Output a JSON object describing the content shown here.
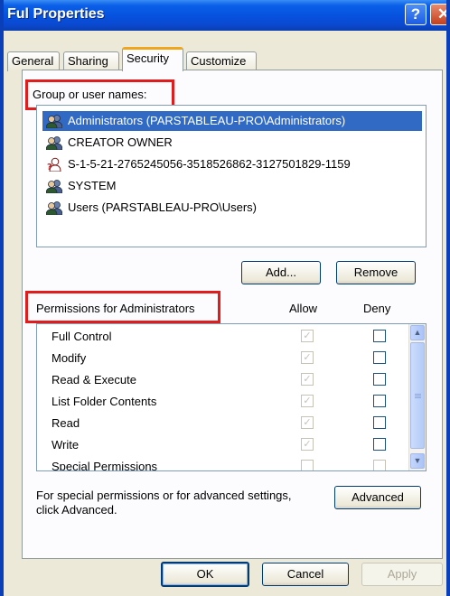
{
  "window": {
    "title": "Ful Properties",
    "help_glyph": "?",
    "close_glyph": "✕"
  },
  "tabs": [
    {
      "label": "General"
    },
    {
      "label": "Sharing"
    },
    {
      "label": "Security"
    },
    {
      "label": "Customize"
    }
  ],
  "users": {
    "heading": "Group or user names:",
    "items": [
      {
        "label": "Administrators (PARSTABLEAU-PRO\\Administrators)",
        "icon": "user-group-icon",
        "selected": true
      },
      {
        "label": "CREATOR OWNER",
        "icon": "user-group-icon"
      },
      {
        "label": "S-1-5-21-2765245056-3518526862-3127501829-1159",
        "icon": "unknown-user-icon"
      },
      {
        "label": "SYSTEM",
        "icon": "user-group-icon"
      },
      {
        "label": "Users (PARSTABLEAU-PRO\\Users)",
        "icon": "user-group-icon"
      }
    ],
    "add_label": "Add...",
    "remove_label": "Remove"
  },
  "permissions": {
    "heading": "Permissions for Administrators",
    "allow_header": "Allow",
    "deny_header": "Deny",
    "items": [
      {
        "label": "Full Control",
        "allow": true,
        "deny": false
      },
      {
        "label": "Modify",
        "allow": true,
        "deny": false
      },
      {
        "label": "Read & Execute",
        "allow": true,
        "deny": false
      },
      {
        "label": "List Folder Contents",
        "allow": true,
        "deny": false
      },
      {
        "label": "Read",
        "allow": true,
        "deny": false
      },
      {
        "label": "Write",
        "allow": true,
        "deny": false
      },
      {
        "label": "Special Permissions",
        "allow": false,
        "deny": false
      }
    ]
  },
  "advanced": {
    "text_line1": "For special permissions or for advanced settings,",
    "text_line2": "click Advanced.",
    "button_label": "Advanced"
  },
  "footer": {
    "ok_label": "OK",
    "cancel_label": "Cancel",
    "apply_label": "Apply"
  },
  "colors": {
    "titlebar": "#0651dd",
    "selection": "#316ac5",
    "highlight_box": "#e01c1c",
    "tab_accent": "#f0a61a"
  }
}
